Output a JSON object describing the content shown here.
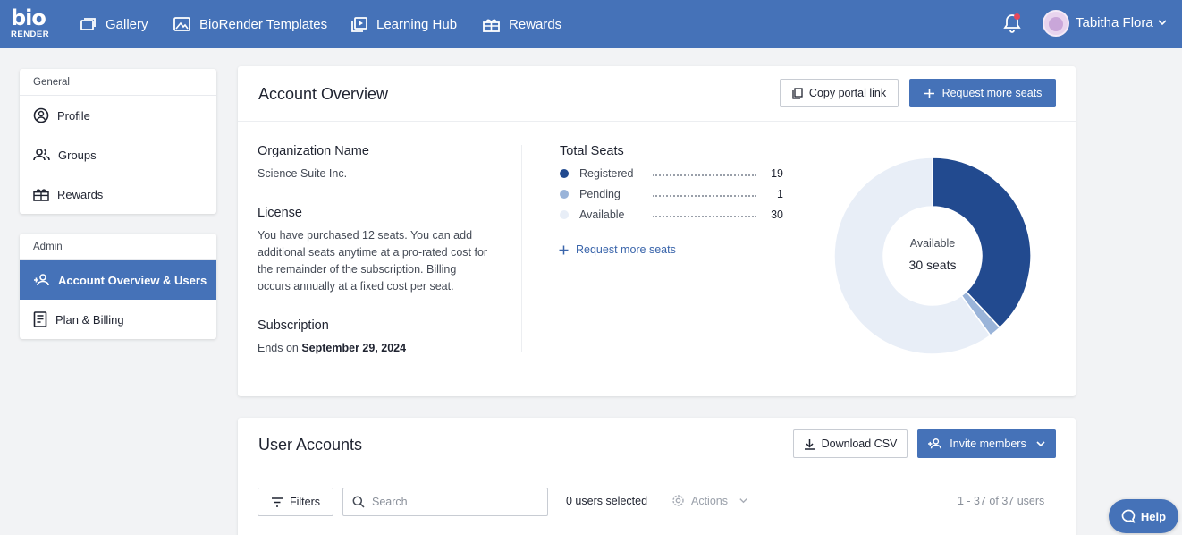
{
  "brand": {
    "logo_top": "bio",
    "logo_bottom": "RENDER"
  },
  "nav": [
    {
      "label": "Gallery",
      "icon": "gallery-icon"
    },
    {
      "label": "BioRender Templates",
      "icon": "image-icon"
    },
    {
      "label": "Learning Hub",
      "icon": "play-icon"
    },
    {
      "label": "Rewards",
      "icon": "gift-icon"
    }
  ],
  "user": {
    "name": "Tabitha Flora"
  },
  "sidebar": {
    "general_header": "General",
    "general_items": [
      {
        "label": "Profile",
        "icon": "profile-icon"
      },
      {
        "label": "Groups",
        "icon": "groups-icon"
      },
      {
        "label": "Rewards",
        "icon": "gift-icon"
      }
    ],
    "admin_header": "Admin",
    "admin_items": [
      {
        "label": "Account Overview & Users",
        "icon": "add-user-icon",
        "active": true
      },
      {
        "label": "Plan & Billing",
        "icon": "billing-icon",
        "active": false
      }
    ]
  },
  "overview": {
    "title": "Account Overview",
    "copy_link_label": "Copy portal link",
    "request_seats_label": "Request more seats",
    "org_label": "Organization Name",
    "org_value": "Science Suite Inc.",
    "license_label": "License",
    "license_text": "You have purchased 12 seats. You can add additional seats anytime at a pro-rated cost for the remainder of the subscription. Billing occurs annually at a fixed cost per seat.",
    "subscription_label": "Subscription",
    "subscription_prefix": "Ends on ",
    "subscription_date": "September 29, 2024",
    "total_seats_label": "Total Seats",
    "request_link_label": "Request more seats",
    "donut_center_label": "Available",
    "donut_center_value": "30 seats"
  },
  "chart_data": {
    "type": "pie",
    "categories": [
      "Registered",
      "Pending",
      "Available"
    ],
    "values": [
      19,
      1,
      30
    ],
    "colors": [
      "#224a8f",
      "#9ab4d9",
      "#e8eef7"
    ]
  },
  "users": {
    "title": "User Accounts",
    "download_label": "Download CSV",
    "invite_label": "Invite members",
    "filters_label": "Filters",
    "search_placeholder": "Search",
    "selected_text": "0 users selected",
    "actions_label": "Actions",
    "range_text": "1 - 37 of 37 users"
  },
  "help_label": "Help"
}
